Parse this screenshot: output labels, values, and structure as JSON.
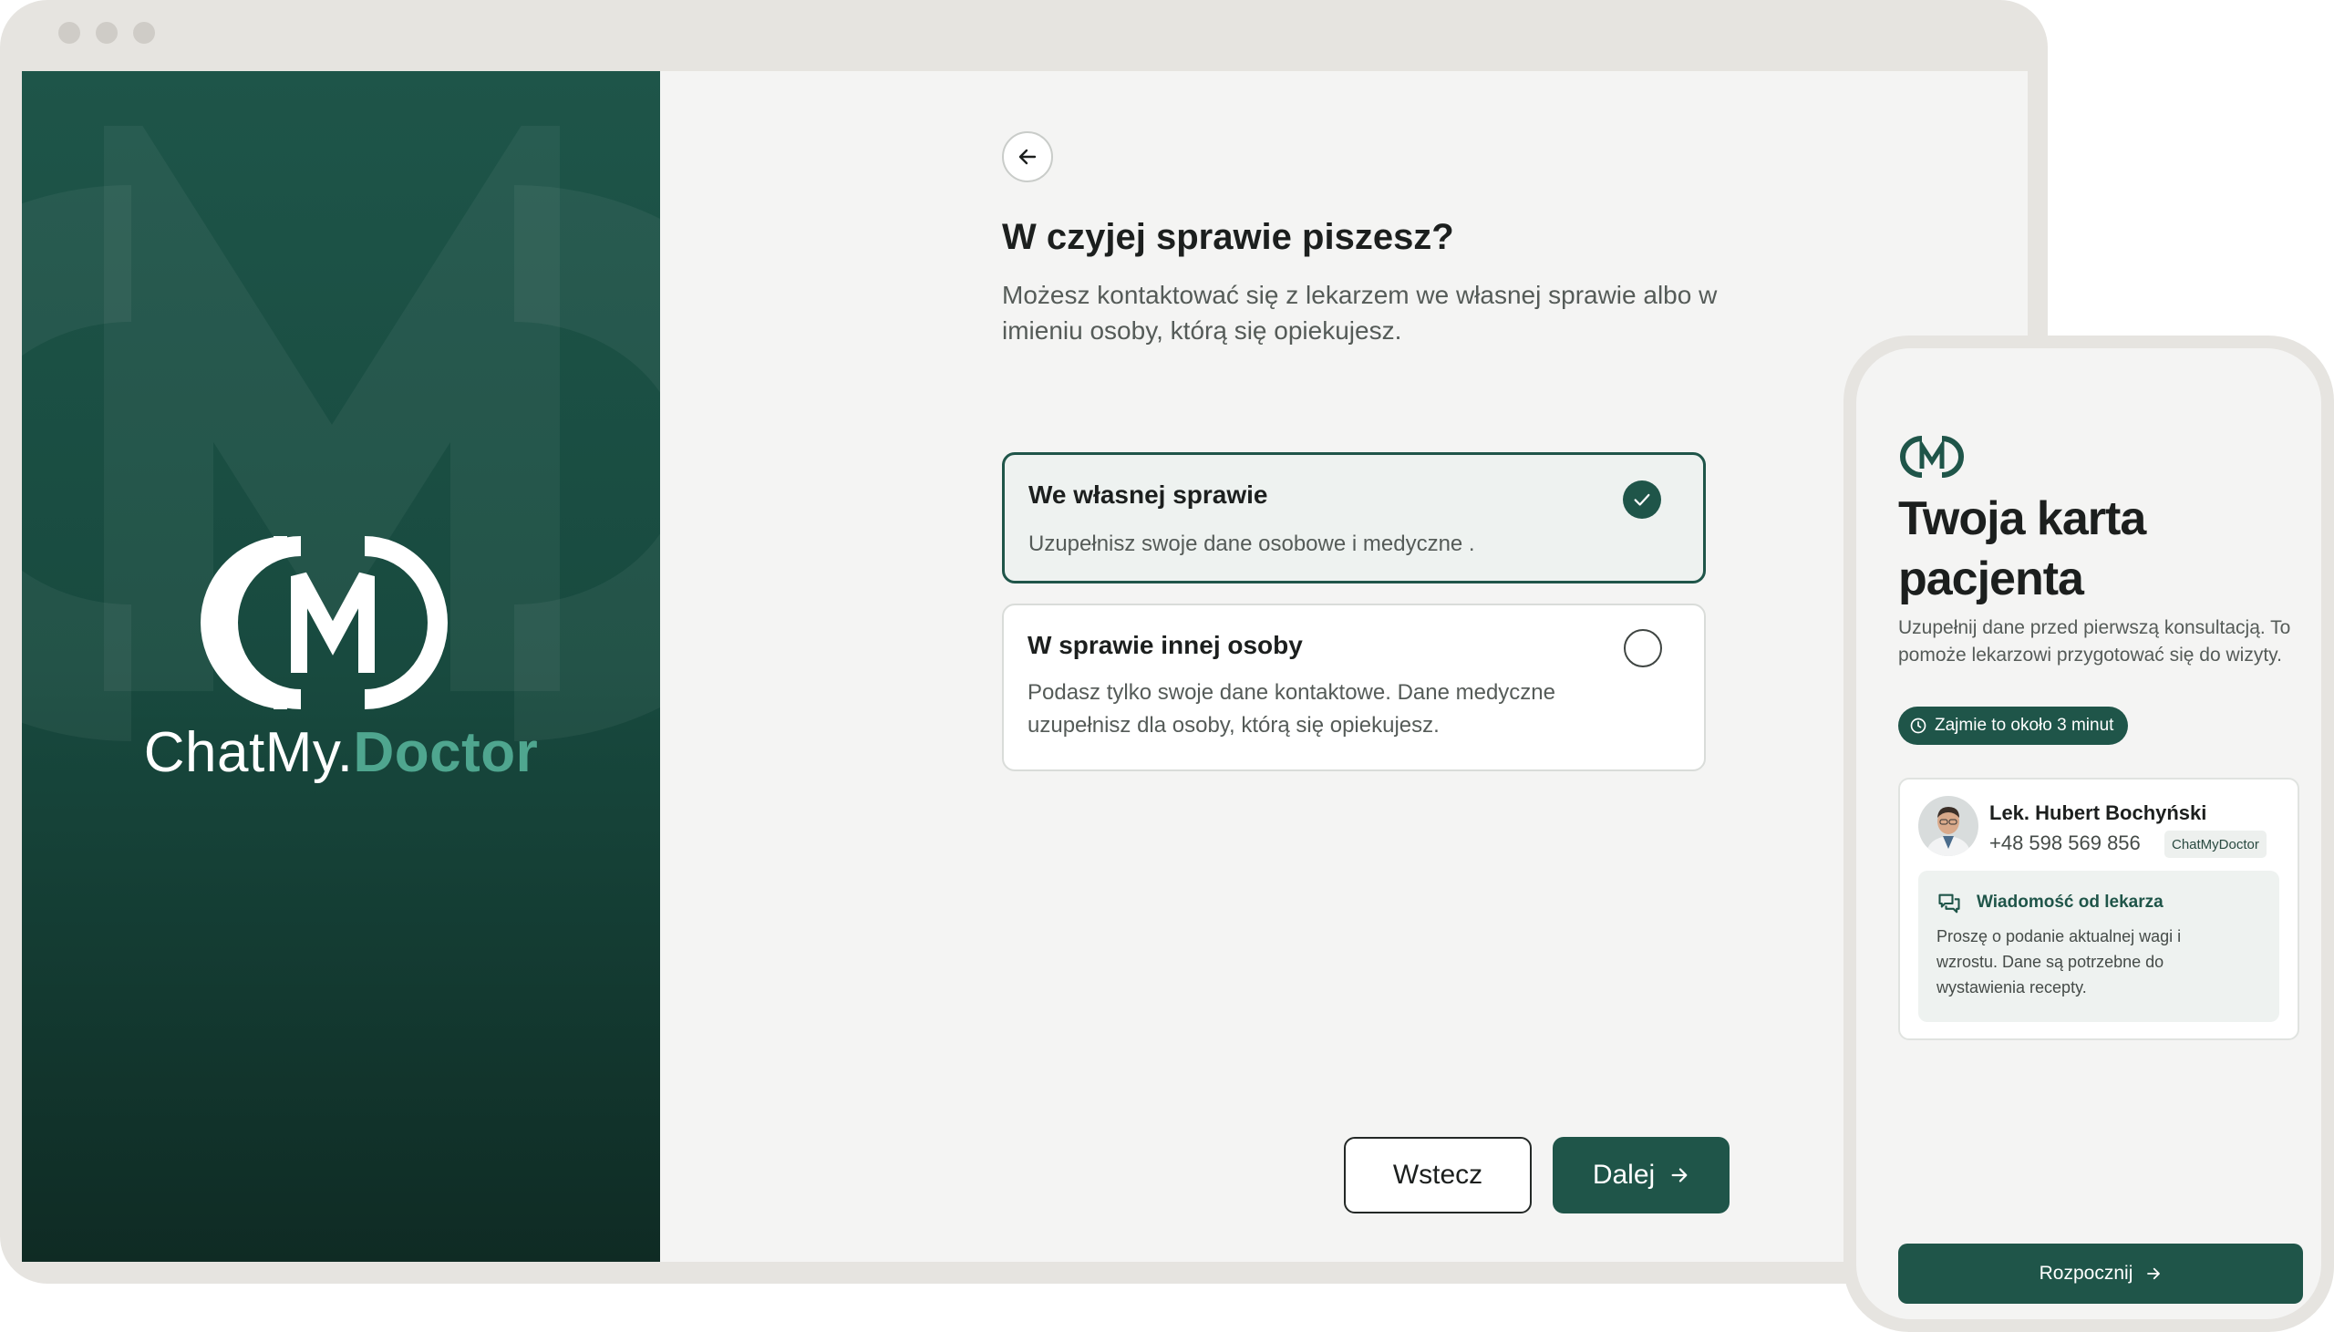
{
  "brand": {
    "name_part1": "ChatMy.",
    "name_part2": "Doctor",
    "logo_icon": "cmd-logo-icon"
  },
  "form": {
    "back_icon": "arrow-left-icon",
    "title": "W czyjej sprawie piszesz?",
    "description": "Możesz kontaktować się z lekarzem we własnej sprawie albo w imieniu osoby, którą się opiekujesz.",
    "options": [
      {
        "title": "We własnej sprawie",
        "description": "Uzupełnisz swoje dane osobowe i medyczne .",
        "selected": true
      },
      {
        "title": "W sprawie innej osoby",
        "description": "Podasz tylko swoje dane kontaktowe. Dane medyczne uzupełnisz dla osoby, którą się opiekujesz.",
        "selected": false
      }
    ],
    "back_button": "Wstecz",
    "next_button": "Dalej"
  },
  "phone": {
    "title": "Twoja karta pacjenta",
    "description": "Uzupełnij dane przed pierwszą konsultacją. To pomoże lekarzowi przygotować się do wizyty.",
    "time_badge": "Zajmie to około 3 minut",
    "doctor": {
      "name": "Lek. Hubert Bochyński",
      "phone": "+48 598 569 856",
      "badge": "ChatMyDoctor"
    },
    "message": {
      "title": "Wiadomość od lekarza",
      "text": "Proszę o podanie aktualnej wagi i wzrostu. Dane są potrzebne do wystawienia recepty."
    },
    "start_button": "Rozpocznij"
  },
  "colors": {
    "brand_green": "#1f5549",
    "brand_accent": "#4fa68f",
    "background": "#f4f4f3"
  }
}
